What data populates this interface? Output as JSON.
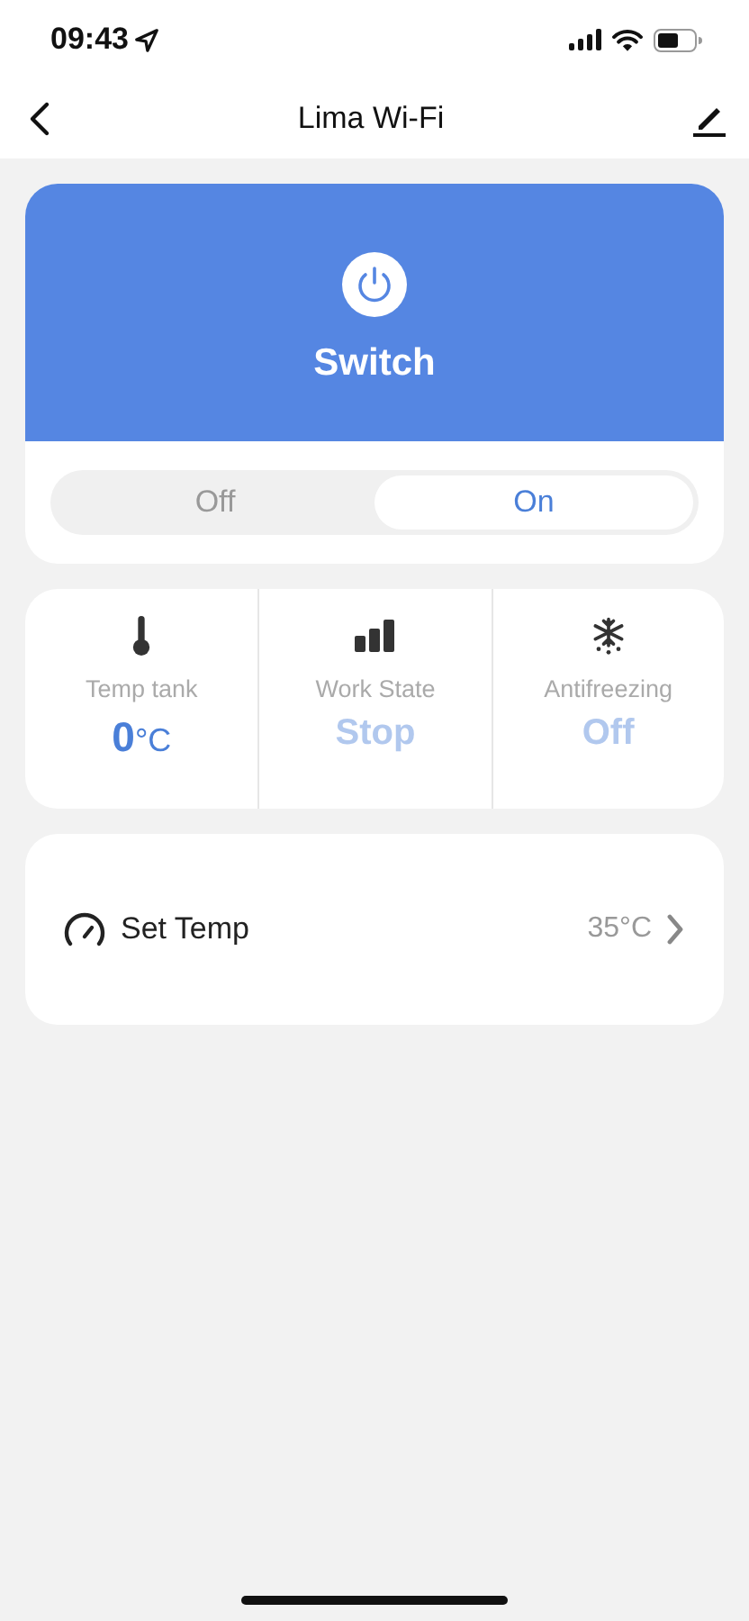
{
  "status_bar": {
    "time": "09:43"
  },
  "nav": {
    "title": "Lima Wi-Fi"
  },
  "power": {
    "label": "Switch",
    "on": true
  },
  "mode_switch": [
    {
      "label": "Off",
      "selected": false
    },
    {
      "label": "On",
      "selected": true
    }
  ],
  "readings": [
    {
      "kind": "thermometer",
      "label": "Temp tank",
      "value": "0",
      "unit": "°C",
      "active": true
    },
    {
      "kind": "bars",
      "label": "Work State",
      "value": "Stop",
      "active": false
    },
    {
      "kind": "snowflake",
      "label": "Antifreezing",
      "value": "Off",
      "active": false
    }
  ],
  "setting": {
    "label": "Set Temp",
    "value": "35°C"
  }
}
